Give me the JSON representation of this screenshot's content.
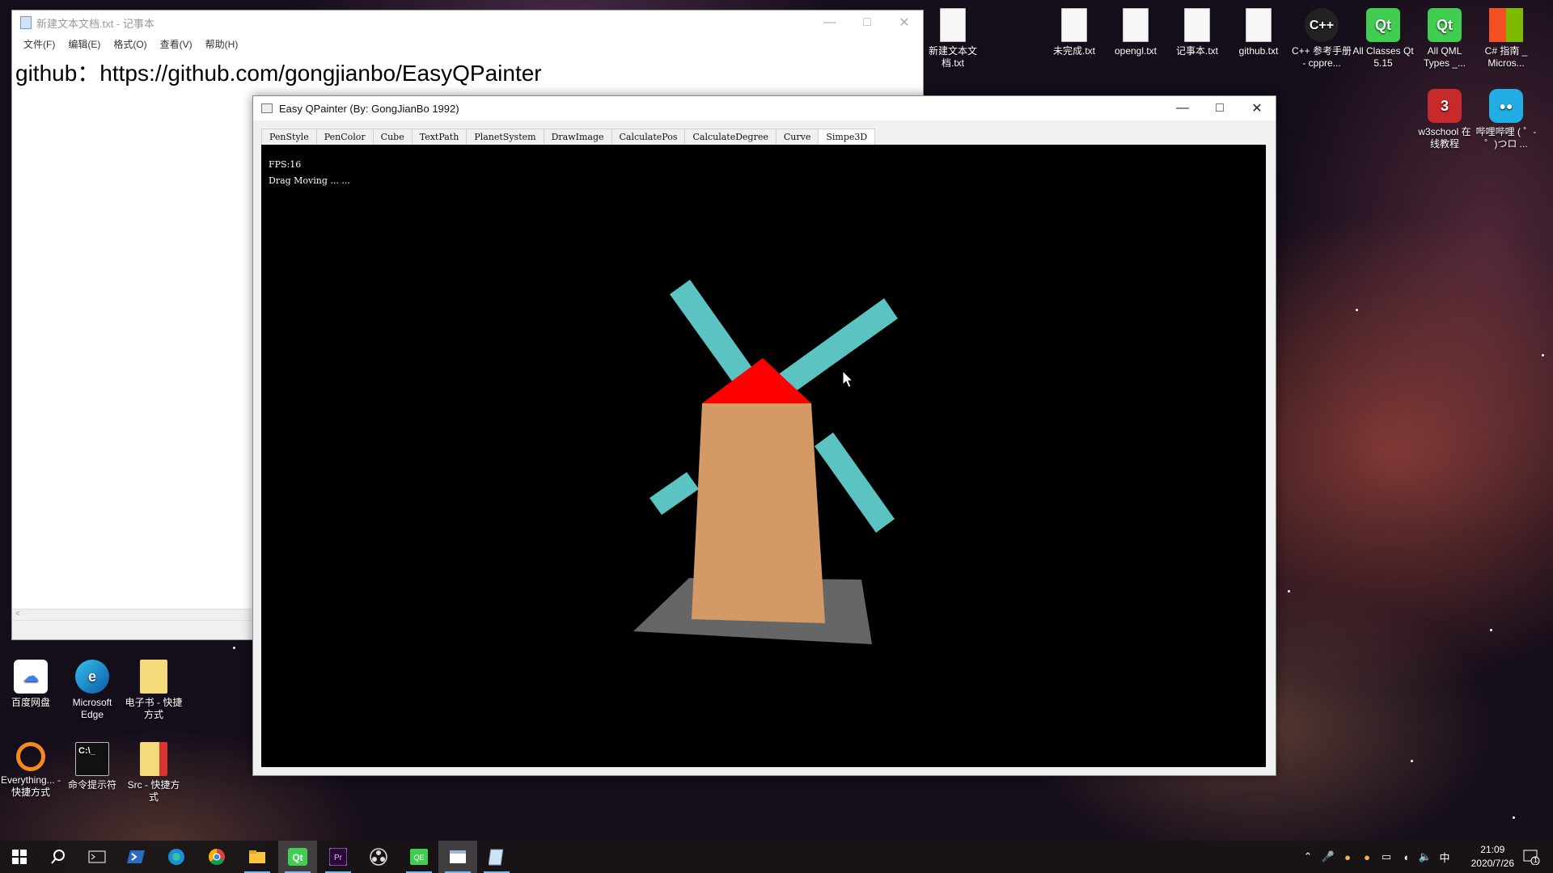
{
  "notepad": {
    "title": "新建文本文档.txt - 记事本",
    "menu": [
      "文件(F)",
      "编辑(E)",
      "格式(O)",
      "查看(V)",
      "帮助(H)"
    ],
    "content": "github：https://github.com/gongjianbo/EasyQPainter"
  },
  "app": {
    "title": "Easy QPainter (By: GongJianBo 1992)",
    "tabs": [
      "PenStyle",
      "PenColor",
      "Cube",
      "TextPath",
      "PlanetSystem",
      "DrawImage",
      "CalculatePos",
      "CalculateDegree",
      "Curve",
      "Simpe3D"
    ],
    "active_tab": "Simpe3D",
    "fps_text": "FPS:16",
    "status_text": "Drag Moving ... ...",
    "colors": {
      "blades": "#5cc3c3",
      "roof": "#ff0000",
      "tower": "#d49a66",
      "ground": "#666666"
    }
  },
  "desktop_icons": {
    "top_right": [
      {
        "label": "新建文本文档.txt",
        "icon": "text-file-icon"
      },
      {
        "label": "未完成.txt",
        "icon": "text-file-icon"
      },
      {
        "label": "opengl.txt",
        "icon": "text-file-icon"
      },
      {
        "label": "记事本.txt",
        "icon": "text-file-icon"
      },
      {
        "label": "github.txt",
        "icon": "text-file-icon"
      },
      {
        "label": "C++ 参考手册 - cppre...",
        "icon": "cpp-icon"
      },
      {
        "label": "All Classes Qt 5.15",
        "icon": "qt-icon"
      },
      {
        "label": "All QML Types _...",
        "icon": "qt-icon"
      },
      {
        "label": "C# 指南 _ Micros...",
        "icon": "windows-icon"
      },
      {
        "label": "w3school 在线教程",
        "icon": "w3school-icon"
      },
      {
        "label": "哔哩哔哩 ( ゜- ゜)つロ ...",
        "icon": "bilibili-icon"
      }
    ],
    "bottom_left": [
      {
        "label": "百度网盘",
        "icon": "baidu-netdisk-icon"
      },
      {
        "label": "Microsoft Edge",
        "icon": "edge-icon"
      },
      {
        "label": "电子书 - 快捷方式",
        "icon": "folder-icon"
      },
      {
        "label": "Everything... - 快捷方式",
        "icon": "everything-icon"
      },
      {
        "label": "命令提示符",
        "icon": "cmd-icon"
      },
      {
        "label": "Src - 快捷方式",
        "icon": "folder-icon"
      }
    ]
  },
  "taskbar": {
    "apps": [
      "start-icon",
      "search-icon",
      "terminal-icon",
      "powershell-icon",
      "edge-icon",
      "chrome-icon",
      "file-explorer-icon",
      "qt-creator-icon",
      "premiere-icon",
      "obs-icon",
      "qt-designer-icon",
      "app-window-icon",
      "notepad-icon"
    ],
    "ime": "中",
    "time": "21:09",
    "date": "2020/7/26",
    "notification_count": "1"
  }
}
